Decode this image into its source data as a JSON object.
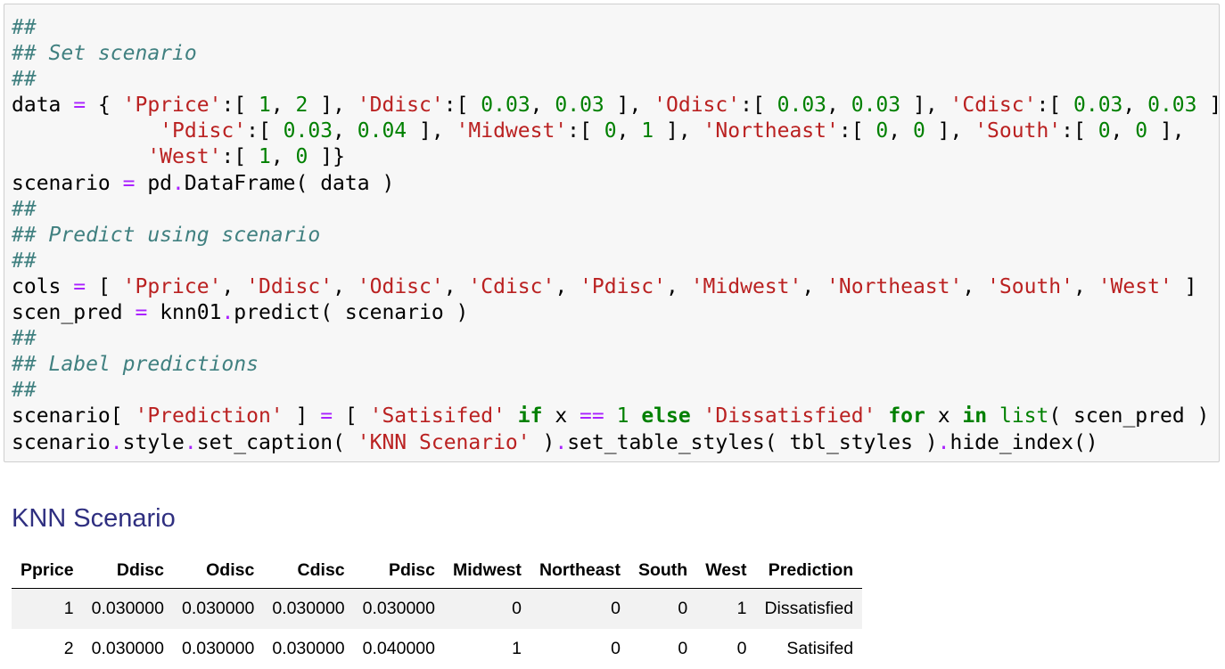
{
  "code_cell": {
    "lines": [
      [
        {
          "t": "##",
          "c": "c"
        }
      ],
      [
        {
          "t": "## Set scenario",
          "c": "c"
        }
      ],
      [
        {
          "t": "##",
          "c": "c"
        }
      ],
      [
        {
          "t": "data "
        },
        {
          "t": "=",
          "c": "o"
        },
        {
          "t": " { "
        },
        {
          "t": "'Pprice'",
          "c": "s"
        },
        {
          "t": ":[ "
        },
        {
          "t": "1",
          "c": "n"
        },
        {
          "t": ", "
        },
        {
          "t": "2",
          "c": "n"
        },
        {
          "t": " ], "
        },
        {
          "t": "'Ddisc'",
          "c": "s"
        },
        {
          "t": ":[ "
        },
        {
          "t": "0.03",
          "c": "n"
        },
        {
          "t": ", "
        },
        {
          "t": "0.03",
          "c": "n"
        },
        {
          "t": " ], "
        },
        {
          "t": "'Odisc'",
          "c": "s"
        },
        {
          "t": ":[ "
        },
        {
          "t": "0.03",
          "c": "n"
        },
        {
          "t": ", "
        },
        {
          "t": "0.03",
          "c": "n"
        },
        {
          "t": " ], "
        },
        {
          "t": "'Cdisc'",
          "c": "s"
        },
        {
          "t": ":[ "
        },
        {
          "t": "0.03",
          "c": "n"
        },
        {
          "t": ", "
        },
        {
          "t": "0.03",
          "c": "n"
        },
        {
          "t": " ],"
        }
      ],
      [
        {
          "t": "            "
        },
        {
          "t": "'Pdisc'",
          "c": "s"
        },
        {
          "t": ":[ "
        },
        {
          "t": "0.03",
          "c": "n"
        },
        {
          "t": ", "
        },
        {
          "t": "0.04",
          "c": "n"
        },
        {
          "t": " ], "
        },
        {
          "t": "'Midwest'",
          "c": "s"
        },
        {
          "t": ":[ "
        },
        {
          "t": "0",
          "c": "n"
        },
        {
          "t": ", "
        },
        {
          "t": "1",
          "c": "n"
        },
        {
          "t": " ], "
        },
        {
          "t": "'Northeast'",
          "c": "s"
        },
        {
          "t": ":[ "
        },
        {
          "t": "0",
          "c": "n"
        },
        {
          "t": ", "
        },
        {
          "t": "0",
          "c": "n"
        },
        {
          "t": " ], "
        },
        {
          "t": "'South'",
          "c": "s"
        },
        {
          "t": ":[ "
        },
        {
          "t": "0",
          "c": "n"
        },
        {
          "t": ", "
        },
        {
          "t": "0",
          "c": "n"
        },
        {
          "t": " ],"
        }
      ],
      [
        {
          "t": "           "
        },
        {
          "t": "'West'",
          "c": "s"
        },
        {
          "t": ":[ "
        },
        {
          "t": "1",
          "c": "n"
        },
        {
          "t": ", "
        },
        {
          "t": "0",
          "c": "n"
        },
        {
          "t": " ]}"
        }
      ],
      [
        {
          "t": "scenario "
        },
        {
          "t": "=",
          "c": "o"
        },
        {
          "t": " pd"
        },
        {
          "t": ".",
          "c": "o"
        },
        {
          "t": "DataFrame( data )"
        }
      ],
      [
        {
          "t": "##",
          "c": "c"
        }
      ],
      [
        {
          "t": "## Predict using scenario",
          "c": "c"
        }
      ],
      [
        {
          "t": "##",
          "c": "c"
        }
      ],
      [
        {
          "t": "cols "
        },
        {
          "t": "=",
          "c": "o"
        },
        {
          "t": " [ "
        },
        {
          "t": "'Pprice'",
          "c": "s"
        },
        {
          "t": ", "
        },
        {
          "t": "'Ddisc'",
          "c": "s"
        },
        {
          "t": ", "
        },
        {
          "t": "'Odisc'",
          "c": "s"
        },
        {
          "t": ", "
        },
        {
          "t": "'Cdisc'",
          "c": "s"
        },
        {
          "t": ", "
        },
        {
          "t": "'Pdisc'",
          "c": "s"
        },
        {
          "t": ", "
        },
        {
          "t": "'Midwest'",
          "c": "s"
        },
        {
          "t": ", "
        },
        {
          "t": "'Northeast'",
          "c": "s"
        },
        {
          "t": ", "
        },
        {
          "t": "'South'",
          "c": "s"
        },
        {
          "t": ", "
        },
        {
          "t": "'West'",
          "c": "s"
        },
        {
          "t": " ]"
        }
      ],
      [
        {
          "t": "scen_pred "
        },
        {
          "t": "=",
          "c": "o"
        },
        {
          "t": " knn01"
        },
        {
          "t": ".",
          "c": "o"
        },
        {
          "t": "predict( scenario )"
        }
      ],
      [
        {
          "t": "##",
          "c": "c"
        }
      ],
      [
        {
          "t": "## Label predictions",
          "c": "c"
        }
      ],
      [
        {
          "t": "##",
          "c": "c"
        }
      ],
      [
        {
          "t": "scenario[ "
        },
        {
          "t": "'Prediction'",
          "c": "s"
        },
        {
          "t": " ] "
        },
        {
          "t": "=",
          "c": "o"
        },
        {
          "t": " [ "
        },
        {
          "t": "'Satisifed'",
          "c": "s"
        },
        {
          "t": " "
        },
        {
          "t": "if",
          "c": "k"
        },
        {
          "t": " x "
        },
        {
          "t": "==",
          "c": "o"
        },
        {
          "t": " "
        },
        {
          "t": "1",
          "c": "n"
        },
        {
          "t": " "
        },
        {
          "t": "else",
          "c": "k"
        },
        {
          "t": " "
        },
        {
          "t": "'Dissatisfied'",
          "c": "s"
        },
        {
          "t": " "
        },
        {
          "t": "for",
          "c": "k"
        },
        {
          "t": " x "
        },
        {
          "t": "in",
          "c": "k"
        },
        {
          "t": " "
        },
        {
          "t": "list",
          "c": "b"
        },
        {
          "t": "( scen_pred ) ]"
        }
      ],
      [
        {
          "t": "scenario"
        },
        {
          "t": ".",
          "c": "o"
        },
        {
          "t": "style"
        },
        {
          "t": ".",
          "c": "o"
        },
        {
          "t": "set_caption( "
        },
        {
          "t": "'KNN Scenario'",
          "c": "s"
        },
        {
          "t": " )"
        },
        {
          "t": ".",
          "c": "o"
        },
        {
          "t": "set_table_styles( tbl_styles )"
        },
        {
          "t": ".",
          "c": "o"
        },
        {
          "t": "hide_index()"
        }
      ]
    ]
  },
  "output": {
    "caption": "KNN Scenario",
    "columns": [
      "Pprice",
      "Ddisc",
      "Odisc",
      "Cdisc",
      "Pdisc",
      "Midwest",
      "Northeast",
      "South",
      "West",
      "Prediction"
    ],
    "rows": [
      [
        "1",
        "0.030000",
        "0.030000",
        "0.030000",
        "0.030000",
        "0",
        "0",
        "0",
        "1",
        "Dissatisfied"
      ],
      [
        "2",
        "0.030000",
        "0.030000",
        "0.030000",
        "0.040000",
        "1",
        "0",
        "0",
        "0",
        "Satisifed"
      ]
    ]
  }
}
